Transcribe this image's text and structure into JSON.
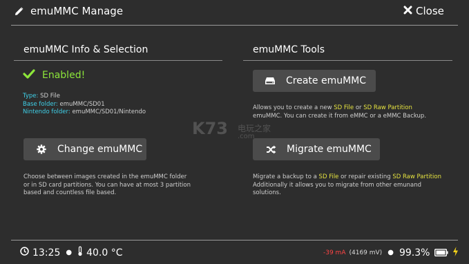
{
  "header": {
    "title": "emuMMC Manage",
    "close_label": "Close"
  },
  "info": {
    "section_title": "emuMMC Info & Selection",
    "status": "Enabled!",
    "type_label": "Type:",
    "type_value": "SD File",
    "base_label": "Base folder:",
    "base_value": "emuMMC/SD01",
    "nintendo_label": "Nintendo folder:",
    "nintendo_value": "emuMMC/SD01/Nintendo",
    "change_button": "Change emuMMC",
    "change_desc_1": "Choose between images created in the emuMMC folder",
    "change_desc_2": "or in SD card partitions. You can have at most 3 partition",
    "change_desc_3": "based and countless file based."
  },
  "tools": {
    "section_title": "emuMMC Tools",
    "create_button": "Create emuMMC",
    "create_desc_1a": "Allows you to create a new ",
    "create_desc_1b": "SD File",
    "create_desc_1c": " or ",
    "create_desc_1d": "SD Raw Partition",
    "create_desc_2": "emuMMC. You can create it from eMMC or a eMMC Backup.",
    "migrate_button": "Migrate emuMMC",
    "migrate_desc_1a": "Migrate a backup to a ",
    "migrate_desc_1b": "SD File",
    "migrate_desc_1c": " or repair existing ",
    "migrate_desc_1d": "SD Raw Partition",
    "migrate_desc_2": "Additionally it allows you to migrate from other emunand",
    "migrate_desc_3": "solutions."
  },
  "footer": {
    "time": "13:25",
    "temp": "40.0 °C",
    "current": "-39 mA",
    "voltage": "(4169 mV)",
    "battery": "99.3%"
  },
  "watermark": {
    "logo": "K73",
    "text": "电玩之家",
    "url": ".com"
  },
  "colors": {
    "background": "#2d2d2d",
    "button": "#4b4b4b",
    "accent_green": "#8de63a",
    "cyan": "#3fd0e8",
    "yellow": "#e5e240",
    "red": "#ff4444"
  },
  "icons": [
    "pencil-icon",
    "close-icon",
    "checkmark-icon",
    "gear-icon",
    "drive-icon",
    "shuffle-icon",
    "clock-icon",
    "thermometer-icon",
    "battery-icon",
    "charging-bolt-icon"
  ]
}
